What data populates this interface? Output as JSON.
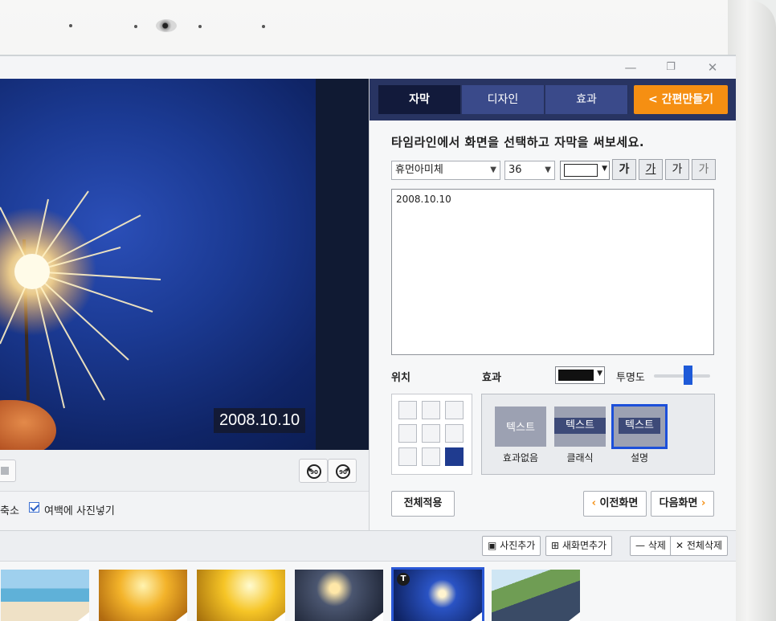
{
  "window": {
    "minimize_icon": "minimize-icon",
    "restore_icon": "restore-icon",
    "close_icon": "close-icon",
    "minimize_glyph": "—",
    "restore_glyph": "❐",
    "close_glyph": "✕"
  },
  "preview": {
    "caption": "2008.10.10",
    "rotate_left_label": "90",
    "rotate_right_label": "90"
  },
  "options": {
    "shrink_label": "축소",
    "fill_margin_label": "여백에 사진넣기",
    "fill_margin_checked": true
  },
  "tabs": [
    {
      "label": "자막",
      "active": true
    },
    {
      "label": "디자인",
      "active": false
    },
    {
      "label": "효과",
      "active": false
    }
  ],
  "easy_button": {
    "label": "간편만들기",
    "chevron": "<",
    "color": "#f58f12"
  },
  "instruction": "타임라인에서 화면을 선택하고 자막을 써보세요.",
  "font": {
    "family": "휴먼아미체",
    "size": "36",
    "color": "#ffffff"
  },
  "style_buttons": [
    "가",
    "가",
    "가",
    "가"
  ],
  "text_content": "2008.10.10",
  "position_label": "위치",
  "effect_label": "효과",
  "effect_color": "#111111",
  "opacity_label": "투명도",
  "opacity_value": 0.6,
  "alignment_selected": "bottom-right",
  "effects": [
    {
      "sample": "텍스트",
      "caption": "효과없음",
      "selected": false
    },
    {
      "sample": "텍스트",
      "caption": "클래식",
      "selected": false
    },
    {
      "sample": "텍스트",
      "caption": "설명",
      "selected": true
    }
  ],
  "buttons": {
    "apply_all": "전체적용",
    "prev": "이전화면",
    "next": "다음화면",
    "prev_chevron": "‹",
    "next_chevron": "›"
  },
  "toolbar": {
    "add_photo": "사진추가",
    "add_screen": "새화면추가",
    "delete": "삭제",
    "delete_all": "전체삭제",
    "delete_glyph": "—",
    "delete_all_glyph": "✕"
  },
  "thumbnails": [
    {
      "name": "beach",
      "badge": ""
    },
    {
      "name": "sunset-mother",
      "badge": ""
    },
    {
      "name": "sunset-child",
      "badge": ""
    },
    {
      "name": "sparkler-hand",
      "badge": ""
    },
    {
      "name": "sparkler-blue",
      "badge": "T",
      "selected": true
    },
    {
      "name": "car-road",
      "badge": ""
    }
  ],
  "colors": {
    "accent": "#1c4fd9",
    "tab_bg": "#283462",
    "orange": "#f58f12"
  }
}
